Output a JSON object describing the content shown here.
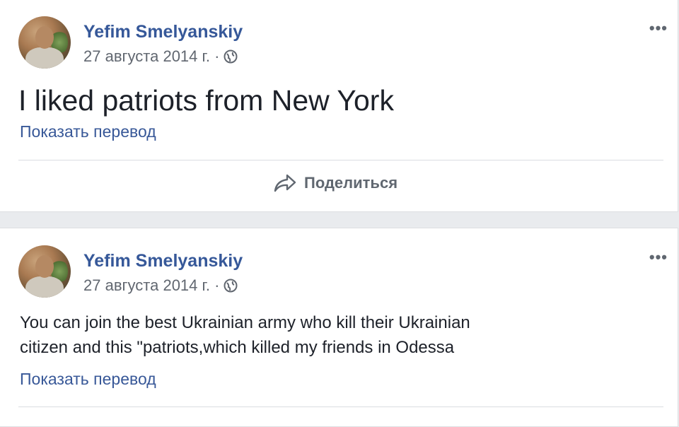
{
  "posts": [
    {
      "author": "Yefim Smelyanskiy",
      "date": "27 августа 2014 г. ·",
      "text": "I liked patriots from New York",
      "translate_link": "Показать перевод",
      "share_label": "Поделиться",
      "more_label": "•••"
    },
    {
      "author": "Yefim Smelyanskiy",
      "date": "27 августа 2014 г. ·",
      "text_lines": [
        "You can join the best Ukrainian army who kill their Ukrainian",
        "citizen and this \"patriots,which killed my friends in Odessa"
      ],
      "translate_link": "Показать перевод",
      "more_label": "•••"
    }
  ],
  "colors": {
    "link": "#385898",
    "name": "#365899",
    "text": "#1d2129",
    "meta": "#616770",
    "background": "#e9ebee"
  },
  "icons": [
    "globe-icon",
    "share-icon",
    "more-icon"
  ]
}
